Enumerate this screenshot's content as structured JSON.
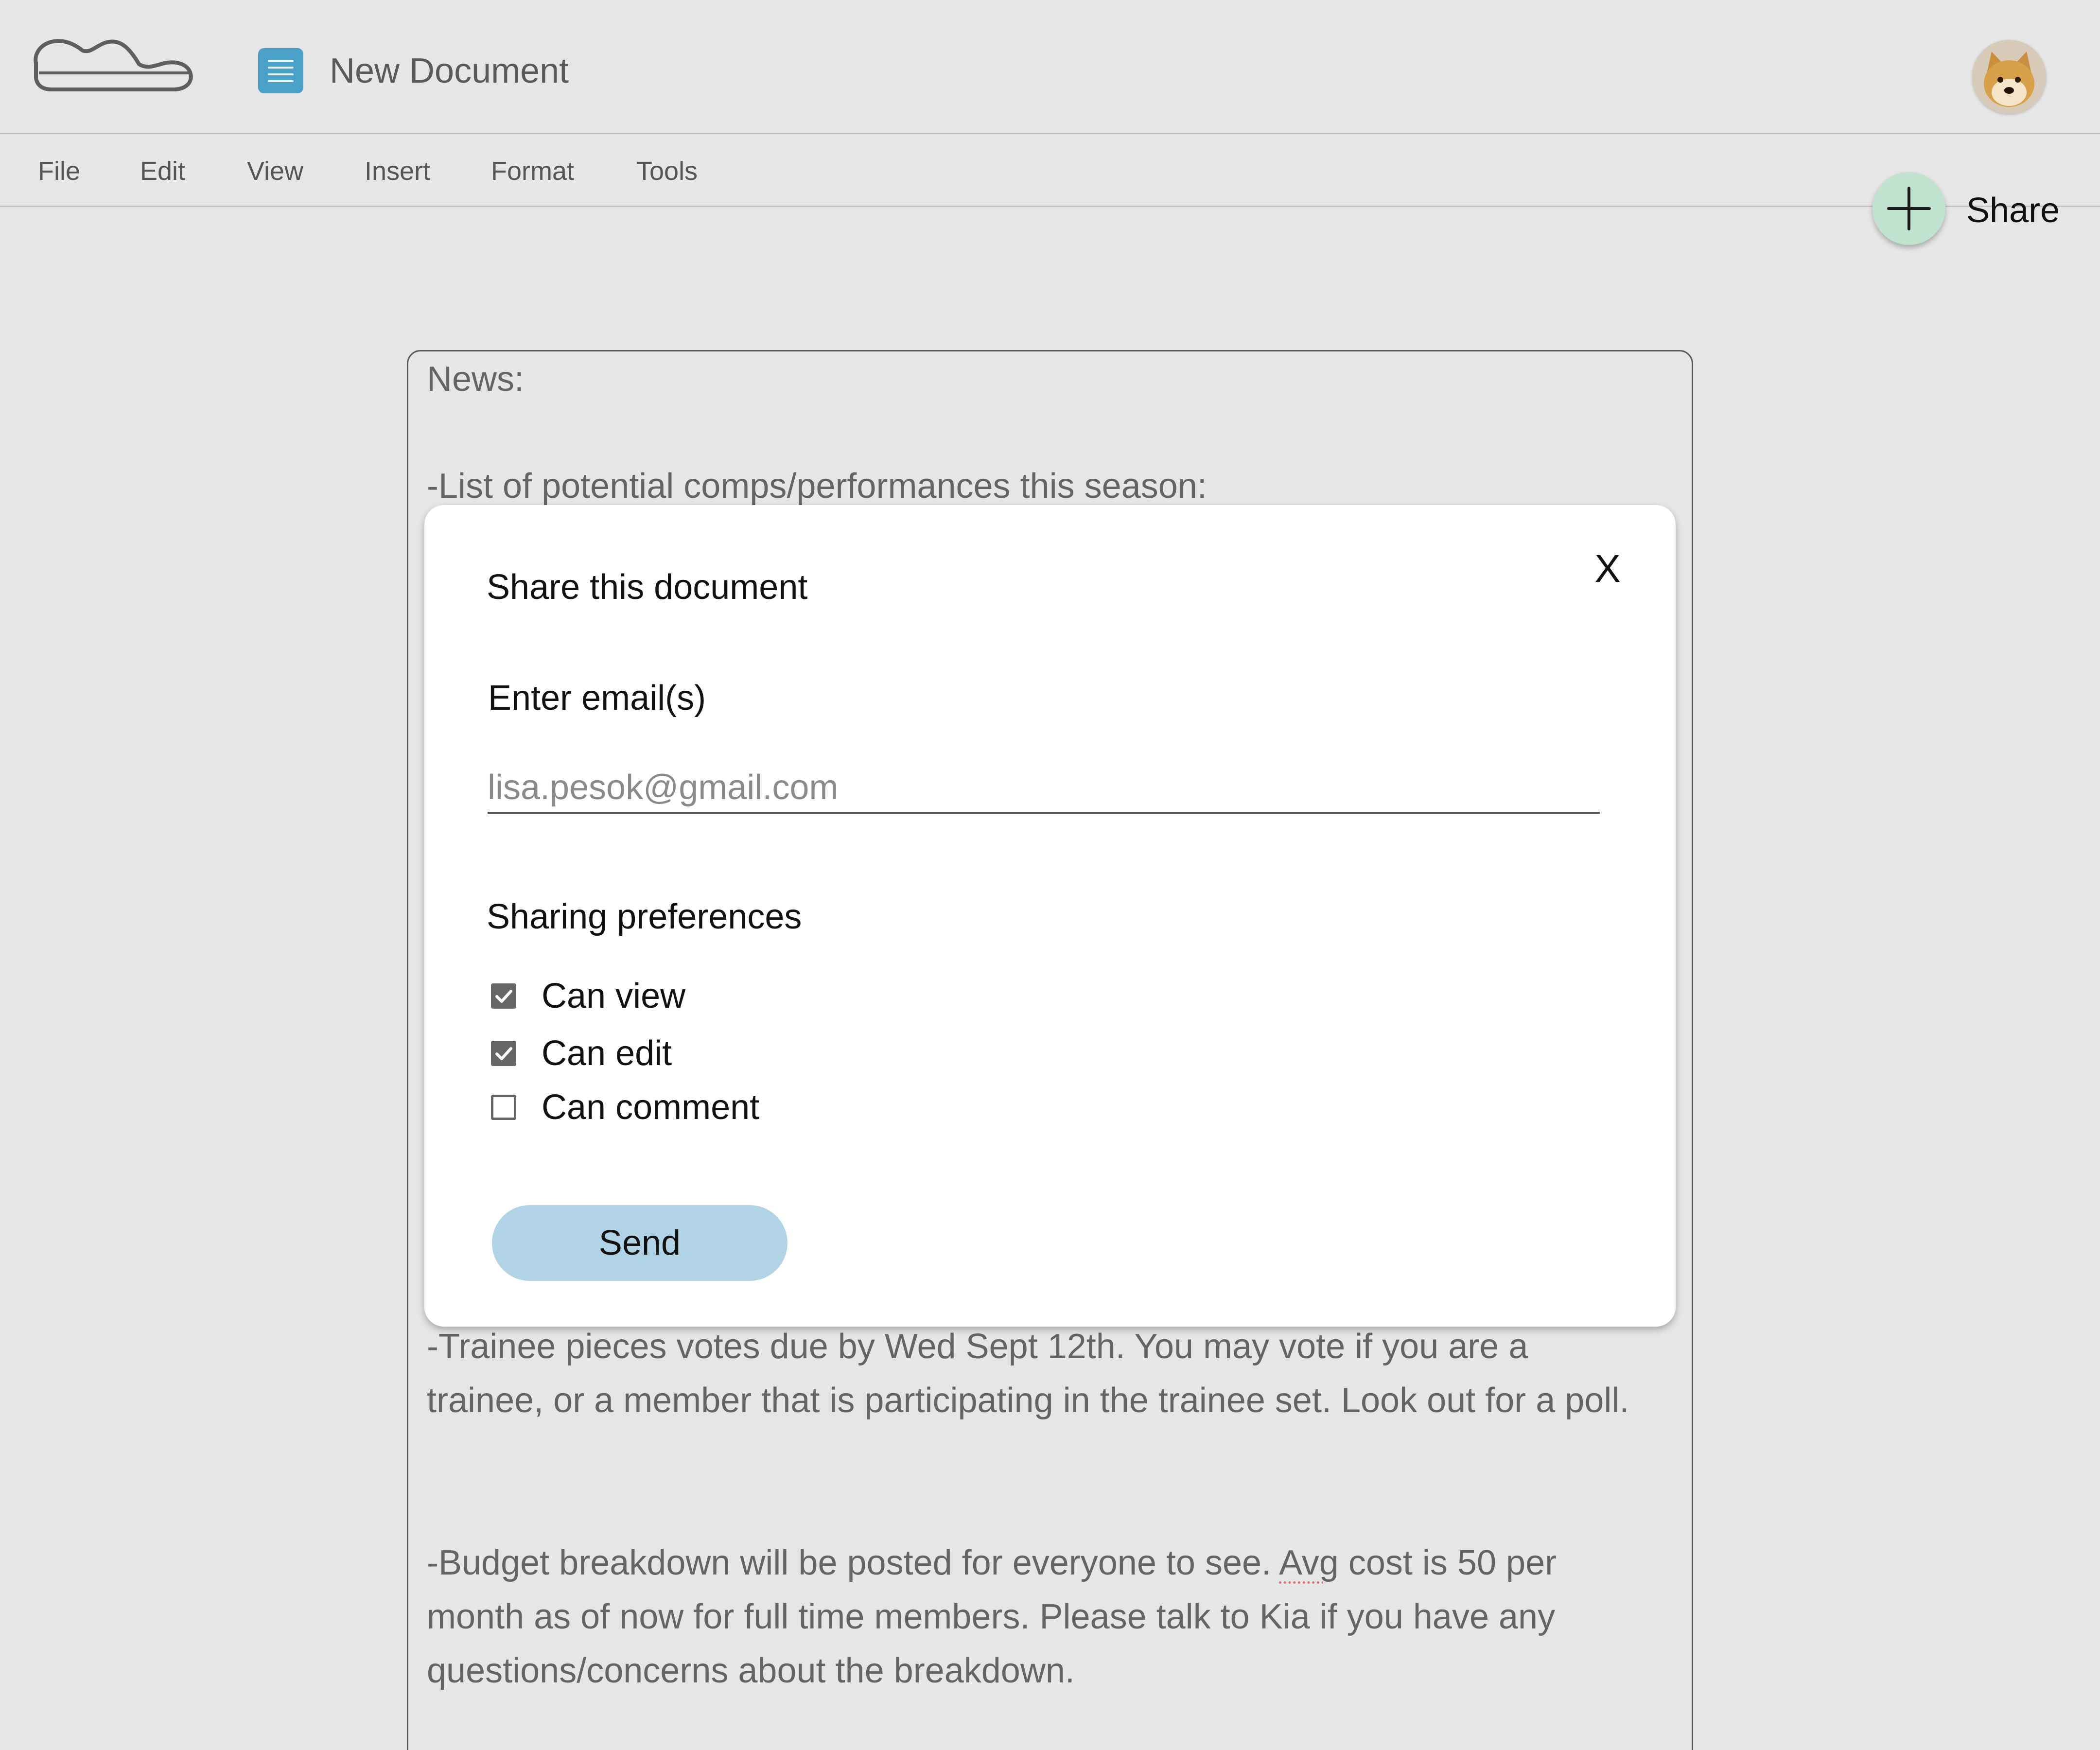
{
  "header": {
    "doc_title": "New Document",
    "logo_icon": "cloud-icon",
    "doc_icon": "document-icon",
    "avatar_icon": "user-avatar-dog"
  },
  "menu": {
    "items": [
      "File",
      "Edit",
      "View",
      "Insert",
      "Format",
      "Tools"
    ]
  },
  "share": {
    "label": "Share",
    "icon": "plus-icon",
    "fab_color": "#bfe3ce"
  },
  "document": {
    "heading": "News:",
    "line1": "-List of potential comps/performances this season:",
    "para_trainee": "-Trainee pieces votes due by Wed Sept 12th. You may vote if you are a trainee, or a member that is participating in the trainee set. Look out for a poll.",
    "para_budget_pre": "-Budget breakdown will be posted for everyone to see. ",
    "para_budget_flagged": "Avg",
    "para_budget_post": " cost is 50 per month as of now for full time members. Please talk to Kia if you have any questions/concerns about the breakdown."
  },
  "modal": {
    "title": "Share this document",
    "close_label": "X",
    "email_label": "Enter email(s)",
    "email_placeholder": "lisa.pesok@gmail.com",
    "email_value": "",
    "prefs_label": "Sharing preferences",
    "prefs": [
      {
        "label": "Can view",
        "checked": true
      },
      {
        "label": "Can edit",
        "checked": true
      },
      {
        "label": "Can comment",
        "checked": false
      }
    ],
    "send_label": "Send",
    "send_color": "#b0d3e6"
  }
}
